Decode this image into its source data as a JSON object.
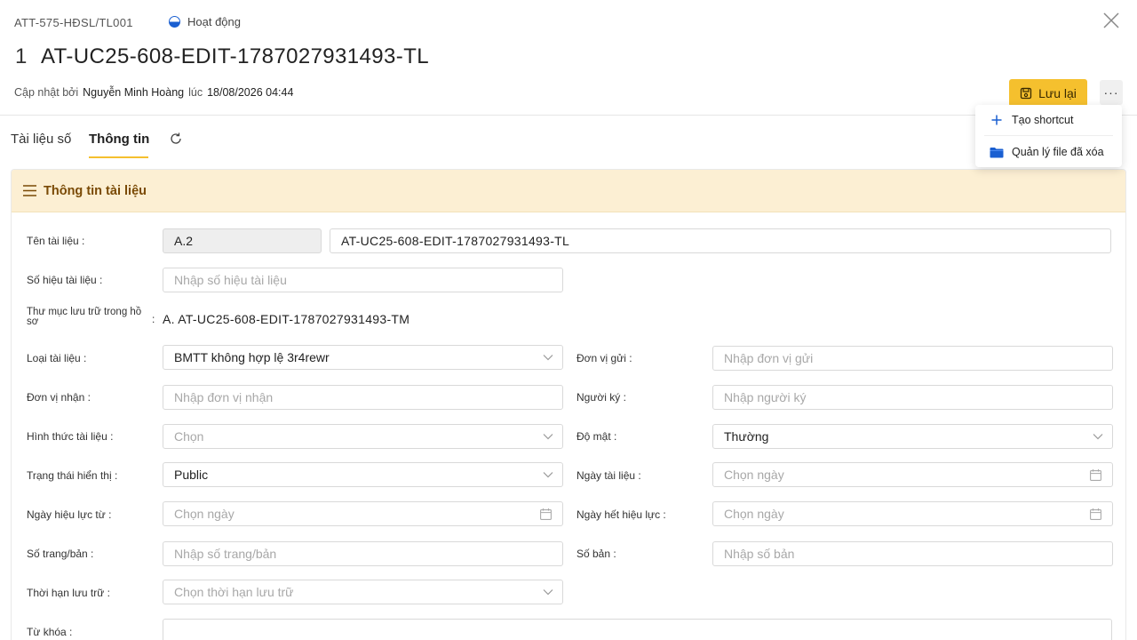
{
  "header": {
    "code": "ATT-575-HĐSL/TL001",
    "status": "Hoạt động",
    "title_number": "1",
    "title": "AT-UC25-608-EDIT-1787027931493-TL",
    "updated_by_label": "Cập nhật bởi",
    "updated_by": "Nguyễn Minh Hoàng",
    "at_label": "lúc",
    "updated_at": "18/08/2026 04:44",
    "save_label": "Lưu lại",
    "more_label": "···"
  },
  "dropdown": {
    "items": [
      {
        "label": "Tạo shortcut",
        "icon": "plus-icon"
      },
      {
        "label": "Quản lý file đã xóa",
        "icon": "folder-icon"
      }
    ]
  },
  "tabs": [
    {
      "label": "Tài liệu số"
    },
    {
      "label": "Thông tin"
    }
  ],
  "card": {
    "title": "Thông tin tài liệu"
  },
  "form": {
    "ten_label": "Tên tài liệu :",
    "ten_prefix": "A.2",
    "ten_value": "AT-UC25-608-EDIT-1787027931493-TL",
    "sohieu_label": "Số hiệu tài liệu :",
    "sohieu_ph": "Nhập số hiệu tài liệu",
    "thumuc_label": "Thư mục lưu trữ trong hồ sơ",
    "thumuc_colon": ":",
    "thumuc_value": "A. AT-UC25-608-EDIT-1787027931493-TM",
    "loai_label": "Loại tài liệu :",
    "loai_value": "BMTT không hợp lệ 3r4rewr",
    "donvigui_label": "Đơn vị gửi :",
    "donvigui_ph": "Nhập đơn vị gửi",
    "donvinhan_label": "Đơn vị nhận :",
    "donvinhan_ph": "Nhập đơn vị nhận",
    "nguoiky_label": "Người ký :",
    "nguoiky_ph": "Nhập người ký",
    "hinhthuc_label": "Hình thức tài liệu :",
    "hinhthuc_ph": "Chọn",
    "domat_label": "Độ mật :",
    "domat_value": "Thường",
    "trangthai_label": "Trạng thái hiển thị :",
    "trangthai_value": "Public",
    "ngaytailieu_label": "Ngày tài liệu :",
    "ngaytailieu_ph": "Chọn ngày",
    "ngayhieuluc_label": "Ngày hiệu lực từ :",
    "ngayhieuluc_ph": "Chọn ngày",
    "ngayhethieuluc_label": "Ngày hết hiệu lực :",
    "ngayhethieuluc_ph": "Chọn ngày",
    "sotrang_label": "Số trang/bản :",
    "sotrang_ph": "Nhập số trang/bản",
    "soban_label": "Số bản :",
    "soban_ph": "Nhập số bản",
    "thoihan_label": "Thời hạn lưu trữ :",
    "thoihan_ph": "Chọn thời hạn lưu trữ",
    "tukhoa_label": "Từ khóa :"
  }
}
